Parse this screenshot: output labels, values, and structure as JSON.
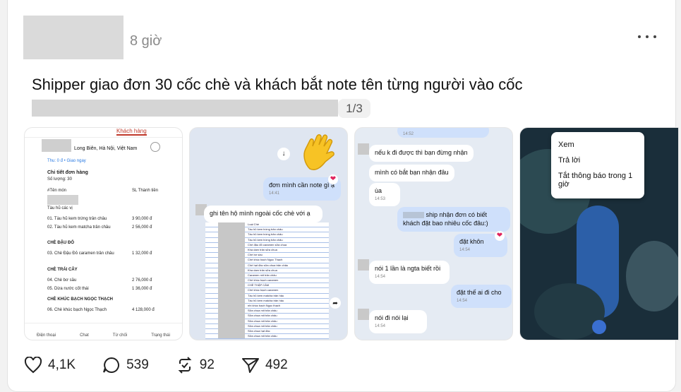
{
  "post": {
    "time": "8 giờ",
    "text": "Shipper giao đơn 30 cốc chè và khách bắt note tên từng người vào cốc",
    "image_counter": "1/3"
  },
  "image1": {
    "tab": "Khách hàng",
    "address": "Long Biên, Hà Nội, Việt Nam",
    "pickup": "Thu: 0 đ • Giao ngay",
    "detail_title": "Chi tiết đơn hàng",
    "quantity": "Số lượng: 30",
    "col_name": "#Tên món",
    "col_qty": "SL  Thành tiền",
    "sec1": "Tàu hũ các vị",
    "items": [
      {
        "name": "01. Tàu hũ kem trứng trân châu",
        "price": "3  90,000 đ"
      },
      {
        "name": "02. Tàu hũ kem matcha trân châu",
        "price": "2  56,000 đ"
      },
      {
        "name": "03. Chè Đậu Đỏ caramen trân châu",
        "price": "1  32,000 đ"
      },
      {
        "name": "04. Chè bơ sầu",
        "price": "2  76,000 đ"
      },
      {
        "name": "05. Dừa nước cốt thái",
        "price": "1  36,000 đ"
      },
      {
        "name": "06. Chè khúc bạch Ngọc Thạch",
        "price": "4  128,000 đ"
      }
    ],
    "sec2": "CHÈ ĐẬU ĐỎ",
    "sec3": "CHÈ TRÁI CÂY",
    "sec4": "CHÈ KHÚC BẠCH NGỌC THẠCH",
    "nav": [
      "Điện thoại",
      "Chat",
      "Từ chối",
      "Trạng thái"
    ]
  },
  "image2": {
    "msg1": "đơn mình cần note gì ạ",
    "msg1_time": "14:41",
    "msg2": "ghi tên hộ mình ngoài cốc chè với ạ",
    "sheet_rows": [
      "Loại Chè",
      "Tàu hũ kem trứng trân châu",
      "Tàu hũ kem trứng trân châu",
      "Tàu hũ kem trứng trân châu",
      "Chè đậu đỏ caramen sữa chua",
      "Kha dam trân sữa chua",
      "Chè bơ sầu",
      "Chè khúc bạch Ngọc Thạch",
      "Chè hạt đác sữa chua trân châu",
      "Kha dam trân sữa chua",
      "Caramen mit trân châu",
      "Chè khúc bạch caramen",
      "CHÈ THẬP CẨM",
      "Chè khúc bạch caramen",
      "Tàu hũ kem matcha trân hâu",
      "Tàu hũ kem matcha trân hâu",
      "nhi khúc bạch Ngọc thạch",
      "Sữa chua mit trân châu",
      "Sữa chua mit trân châu",
      "Sữa chua mit trân châu",
      "Sữa chua mit trân châu",
      "Sữa chua hạt đác",
      "Sữa chua mit trân châu",
      "Sữa chua mit trân châu"
    ]
  },
  "image3": {
    "msg0_time": "14:52",
    "msg1": "nếu k đi được thì bạn đừng nhận",
    "msg2": "mình có bắt bạn nhận đâu",
    "msg3": "ùa",
    "msg3_time": "14:53",
    "msg4": "ship nhận đơn có biết khách đặt bao nhiêu cốc đâu:)",
    "msg5": "đặt khôn",
    "msg5_time": "14:54",
    "msg6": "nói 1 lần là ngta biết rồi",
    "msg6_time": "14:54",
    "msg7": "đặt thế ai đi cho",
    "msg7_time": "14:54",
    "msg8": "nói đi nói lại",
    "msg8_time": "14:54"
  },
  "image4": {
    "menu": [
      "Xem",
      "Trả lời",
      "Tắt thông báo trong 1 giờ"
    ]
  },
  "actions": {
    "likes": "4,1K",
    "comments": "539",
    "reposts": "92",
    "shares": "492"
  }
}
